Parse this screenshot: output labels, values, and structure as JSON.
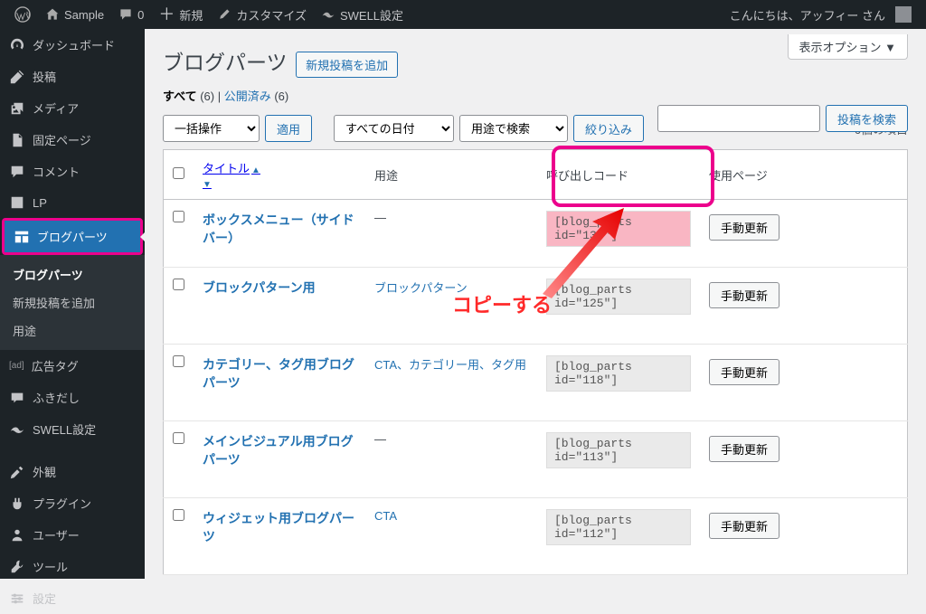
{
  "adminbar": {
    "site": "Sample",
    "comments": "0",
    "new": "新規",
    "customize": "カスタマイズ",
    "swell": "SWELL設定",
    "greeting": "こんにちは、アッフィー さん"
  },
  "sidebar": {
    "dashboard": "ダッシュボード",
    "posts": "投稿",
    "media": "メディア",
    "pages": "固定ページ",
    "comments": "コメント",
    "lp": "LP",
    "blog_parts": "ブログパーツ",
    "sub_blog_parts": "ブログパーツ",
    "sub_add_new": "新規投稿を追加",
    "sub_usage": "用途",
    "ad_tag_prefix": "[ad]",
    "ad_tag": "広告タグ",
    "fukidashi": "ふきだし",
    "swell": "SWELL設定",
    "appearance": "外観",
    "plugins": "プラグイン",
    "users": "ユーザー",
    "tools": "ツール",
    "settings": "設定"
  },
  "screen_options": "表示オプション ▼",
  "page_title": "ブログパーツ",
  "add_new": "新規投稿を追加",
  "subsubsub": {
    "all_label": "すべて",
    "all_count": "(6)",
    "sep": " | ",
    "published_label": "公開済み",
    "published_count": "(6)"
  },
  "search_btn": "投稿を検索",
  "bulk": {
    "placeholder": "一括操作",
    "apply": "適用"
  },
  "filters": {
    "date": "すべての日付",
    "usage": "用途で検索",
    "filter": "絞り込み"
  },
  "count_text": "6個の項目",
  "columns": {
    "title": "タイトル",
    "usage": "用途",
    "code": "呼び出しコード",
    "page": "使用ページ"
  },
  "rows": [
    {
      "title": "ボックスメニュー（サイドバー）",
      "usage": "—",
      "code": "[blog_parts id=\"139\"]",
      "btn": "手動更新",
      "hl": true
    },
    {
      "title": "ブロックパターン用",
      "usage_link": "ブロックパターン",
      "code": "[blog_parts id=\"125\"]",
      "btn": "手動更新"
    },
    {
      "title": "カテゴリー、タグ用ブログパーツ",
      "usage_link": "CTA、カテゴリー用、タグ用",
      "code": "[blog_parts id=\"118\"]",
      "btn": "手動更新"
    },
    {
      "title": "メインビジュアル用ブログパーツ",
      "usage": "—",
      "code": "[blog_parts id=\"113\"]",
      "btn": "手動更新"
    },
    {
      "title": "ウィジェット用ブログパーツ",
      "usage_link": "CTA",
      "code": "[blog_parts id=\"112\"]",
      "btn": "手動更新"
    }
  ],
  "annotation": "コピーする"
}
